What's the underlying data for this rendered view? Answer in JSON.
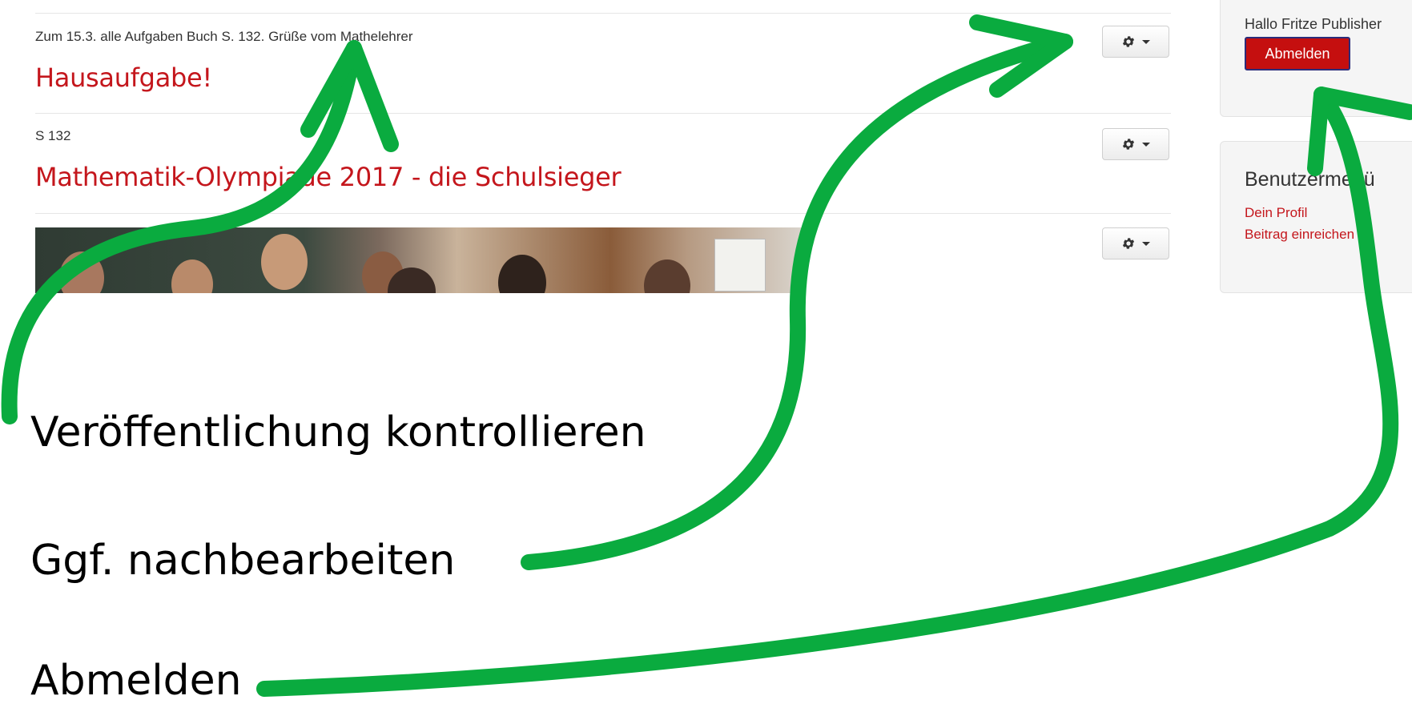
{
  "posts": [
    {
      "intro": "Zum 15.3. alle Aufgaben Buch S. 132. Grüße vom Mathelehrer",
      "title": "Hausaufgabe!"
    },
    {
      "intro": "S 132",
      "title": "Mathematik-Olympiade 2017 - die Schulsieger"
    }
  ],
  "sidebar": {
    "greeting": "Hallo Fritze Publisher",
    "logout_label": "Abmelden",
    "menu_heading": "Benutzermenü",
    "menu_items": [
      {
        "label": "Dein Profil"
      },
      {
        "label": "Beitrag einreichen"
      }
    ]
  },
  "annotations": {
    "check_publication": "Veröffentlichung kontrollieren",
    "edit_if_needed": "Ggf. nachbearbeiten",
    "logout": "Abmelden"
  },
  "colors": {
    "arrow": "#0aab3f",
    "title": "#c4161c",
    "logout_button": "#c50f0f"
  },
  "icons": [
    "gear-icon",
    "caret-down-icon"
  ]
}
